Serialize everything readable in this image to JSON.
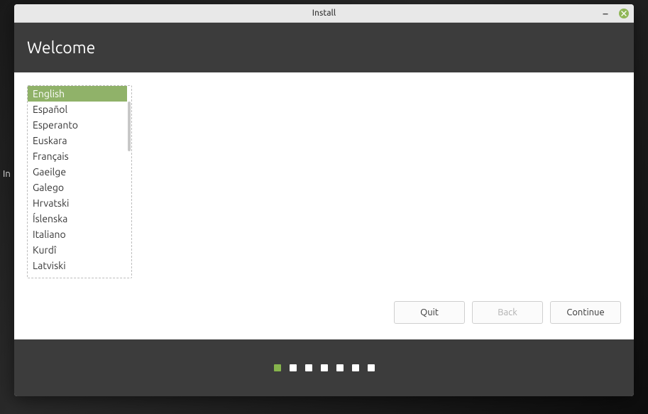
{
  "window": {
    "title": "Install"
  },
  "header": {
    "title": "Welcome"
  },
  "languages": {
    "selected_index": 0,
    "items": [
      "English",
      "Español",
      "Esperanto",
      "Euskara",
      "Français",
      "Gaeilge",
      "Galego",
      "Hrvatski",
      "Íslenska",
      "Italiano",
      "Kurdî",
      "Latviski"
    ]
  },
  "buttons": {
    "quit": "Quit",
    "back": "Back",
    "continue": "Continue"
  },
  "progress": {
    "total": 7,
    "current": 0
  },
  "stray": "In"
}
